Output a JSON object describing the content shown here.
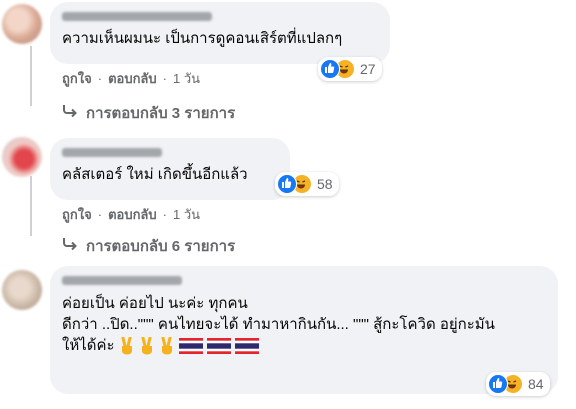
{
  "comments": [
    {
      "text": "ความเห็นผมนะ เป็นการดูคอนเสิร์ตที่แปลกๆ",
      "reaction_count": "27",
      "like": "ถูกใจ",
      "reply": "ตอบกลับ",
      "sep": "·",
      "time": "1 วัน",
      "replies": "การตอบกลับ 3 รายการ"
    },
    {
      "text": "คลัสเตอร์ ใหม่ เกิดขึ้นอีกแล้ว",
      "reaction_count": "58",
      "like": "ถูกใจ",
      "reply": "ตอบกลับ",
      "sep": "·",
      "time": "1 วัน",
      "replies": "การตอบกลับ 6 รายการ"
    },
    {
      "text": "ค่อยเป็น ค่อยไป นะค่ะ ทุกคน\nดีกว่า ..ปิด..\"\"\" คนไทยจะได้ ทำมาหากินกัน... \"\"\" สู้กะโควิด อยู่กะมัน\nให้ได้ค่ะ",
      "reaction_count": "84"
    }
  ],
  "icons": {
    "like": "like-reaction-icon",
    "haha": "haha-reaction-icon",
    "reply_arrow": "reply-arrow-icon",
    "victory": "victory-hand-emoji",
    "flag": "thailand-flag-emoji"
  },
  "colors": {
    "bubble": "#f0f2f5",
    "like_blue": "#1877f2",
    "haha_yellow": "#f7b125",
    "meta_gray": "#65676b"
  }
}
